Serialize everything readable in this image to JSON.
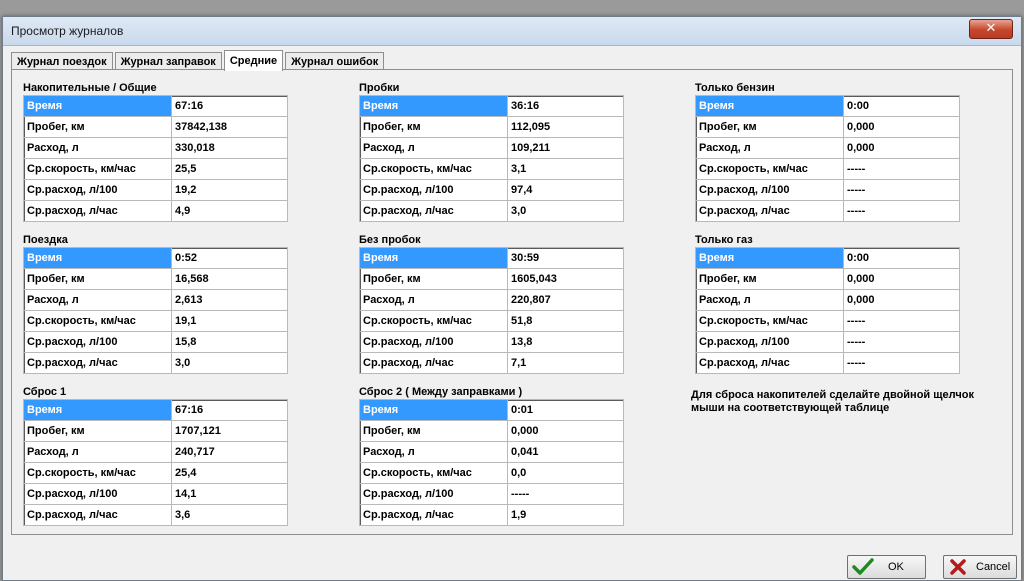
{
  "window": {
    "title": "Просмотр журналов"
  },
  "tabs": [
    {
      "label": "Журнал поездок",
      "active": false
    },
    {
      "label": "Журнал заправок",
      "active": false
    },
    {
      "label": "Средние",
      "active": true
    },
    {
      "label": "Журнал ошибок",
      "active": false
    }
  ],
  "groups": [
    {
      "title": "Накопительные / Общие",
      "rows": [
        [
          "Время",
          "67:16"
        ],
        [
          "Пробег, км",
          "37842,138"
        ],
        [
          "Расход, л",
          "330,018"
        ],
        [
          "Ср.скорость, км/час",
          "25,5"
        ],
        [
          "Ср.расход, л/100",
          "19,2"
        ],
        [
          "Ср.расход, л/час",
          "4,9"
        ]
      ]
    },
    {
      "title": "Пробки",
      "rows": [
        [
          "Время",
          "36:16"
        ],
        [
          "Пробег, км",
          "112,095"
        ],
        [
          "Расход, л",
          "109,211"
        ],
        [
          "Ср.скорость, км/час",
          "3,1"
        ],
        [
          "Ср.расход, л/100",
          "97,4"
        ],
        [
          "Ср.расход, л/час",
          "3,0"
        ]
      ]
    },
    {
      "title": "Только бензин",
      "rows": [
        [
          "Время",
          "0:00"
        ],
        [
          "Пробег, км",
          "0,000"
        ],
        [
          "Расход, л",
          "0,000"
        ],
        [
          "Ср.скорость, км/час",
          "-----"
        ],
        [
          "Ср.расход, л/100",
          "-----"
        ],
        [
          "Ср.расход, л/час",
          "-----"
        ]
      ]
    },
    {
      "title": "Поездка",
      "rows": [
        [
          "Время",
          "0:52"
        ],
        [
          "Пробег, км",
          "16,568"
        ],
        [
          "Расход, л",
          "2,613"
        ],
        [
          "Ср.скорость, км/час",
          "19,1"
        ],
        [
          "Ср.расход, л/100",
          "15,8"
        ],
        [
          "Ср.расход, л/час",
          "3,0"
        ]
      ]
    },
    {
      "title": "Без пробок",
      "rows": [
        [
          "Время",
          "30:59"
        ],
        [
          "Пробег, км",
          "1605,043"
        ],
        [
          "Расход, л",
          "220,807"
        ],
        [
          "Ср.скорость, км/час",
          "51,8"
        ],
        [
          "Ср.расход, л/100",
          "13,8"
        ],
        [
          "Ср.расход, л/час",
          "7,1"
        ]
      ]
    },
    {
      "title": "Только газ",
      "rows": [
        [
          "Время",
          "0:00"
        ],
        [
          "Пробег, км",
          "0,000"
        ],
        [
          "Расход, л",
          "0,000"
        ],
        [
          "Ср.скорость, км/час",
          "-----"
        ],
        [
          "Ср.расход, л/100",
          "-----"
        ],
        [
          "Ср.расход, л/час",
          "-----"
        ]
      ]
    },
    {
      "title": "Сброс 1",
      "rows": [
        [
          "Время",
          "67:16"
        ],
        [
          "Пробег, км",
          "1707,121"
        ],
        [
          "Расход, л",
          "240,717"
        ],
        [
          "Ср.скорость, км/час",
          "25,4"
        ],
        [
          "Ср.расход, л/100",
          "14,1"
        ],
        [
          "Ср.расход, л/час",
          "3,6"
        ]
      ]
    },
    {
      "title": "Сброс 2 ( Между заправками )",
      "rows": [
        [
          "Время",
          "0:01"
        ],
        [
          "Пробег, км",
          "0,000"
        ],
        [
          "Расход, л",
          "0,041"
        ],
        [
          "Ср.скорость, км/час",
          "0,0"
        ],
        [
          "Ср.расход, л/100",
          "-----"
        ],
        [
          "Ср.расход, л/час",
          "1,9"
        ]
      ]
    }
  ],
  "note": "Для сброса накопителей сделайте двойной щелчок мыши на соответствующей таблице",
  "buttons": {
    "ok": "OK",
    "cancel": "Cancel"
  },
  "colors": {
    "selection": "#3399ff",
    "check": "#1f8a1f",
    "cancel_x": "#b51a1a"
  }
}
